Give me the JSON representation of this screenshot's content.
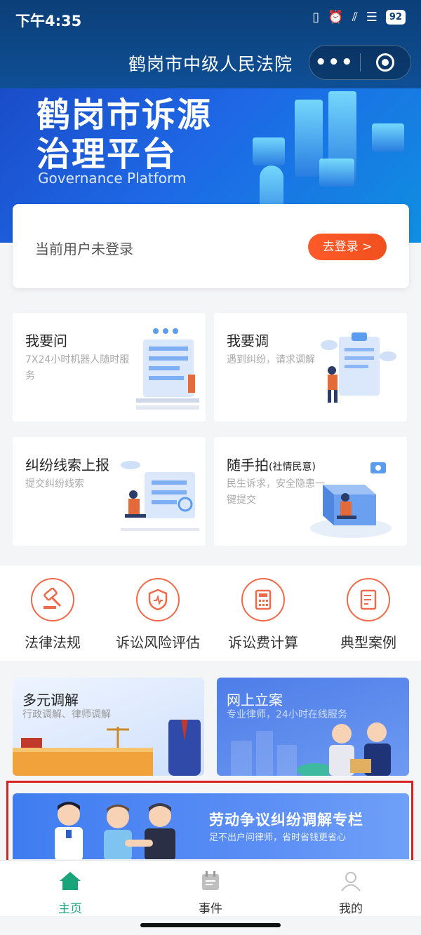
{
  "status_bar": {
    "time": "下午4:35",
    "battery": "92",
    "icons": [
      "vibrate-icon",
      "alarm-icon",
      "signal-icon",
      "wifi-icon",
      "battery-icon"
    ]
  },
  "nav": {
    "title": "鹤岗市中级人民法院",
    "more_label": "•••"
  },
  "banner": {
    "title_line1": "鹤岗市诉源",
    "title_line2": "治理平台",
    "subtitle": "Governance Platform"
  },
  "login": {
    "text": "当前用户未登录",
    "button": "去登录 >"
  },
  "features": [
    {
      "title": "我要问",
      "desc": "7X24小时机器人随时服务"
    },
    {
      "title": "我要调",
      "desc": "遇到纠纷，请求调解"
    },
    {
      "title": "纠纷线索上报",
      "desc": "提交纠纷线索"
    },
    {
      "title": "随手拍",
      "title_suffix": "(社情民意)",
      "desc": "民生诉求，安全隐患一键提交"
    }
  ],
  "tools": [
    {
      "label": "法律法规",
      "icon": "gavel-icon"
    },
    {
      "label": "诉讼风险评估",
      "icon": "shield-icon"
    },
    {
      "label": "诉讼费计算",
      "icon": "calculator-icon"
    },
    {
      "label": "典型案例",
      "icon": "document-icon"
    }
  ],
  "services": [
    {
      "title": "多元调解",
      "desc": "行政调解、律师调解"
    },
    {
      "title": "网上立案",
      "desc": "专业律师，24小时在线服务"
    }
  ],
  "labor": {
    "title": "劳动争议纠纷调解专栏",
    "desc": "足不出户问律师，省时省钱更省心"
  },
  "tabbar": [
    {
      "label": "主页",
      "icon": "home-icon",
      "active": true
    },
    {
      "label": "事件",
      "icon": "calendar-icon",
      "active": false
    },
    {
      "label": "我的",
      "icon": "user-icon",
      "active": false
    }
  ],
  "colors": {
    "accent": "#f0501e",
    "tab_active": "#1aa47a",
    "header": "#0f4f95"
  }
}
